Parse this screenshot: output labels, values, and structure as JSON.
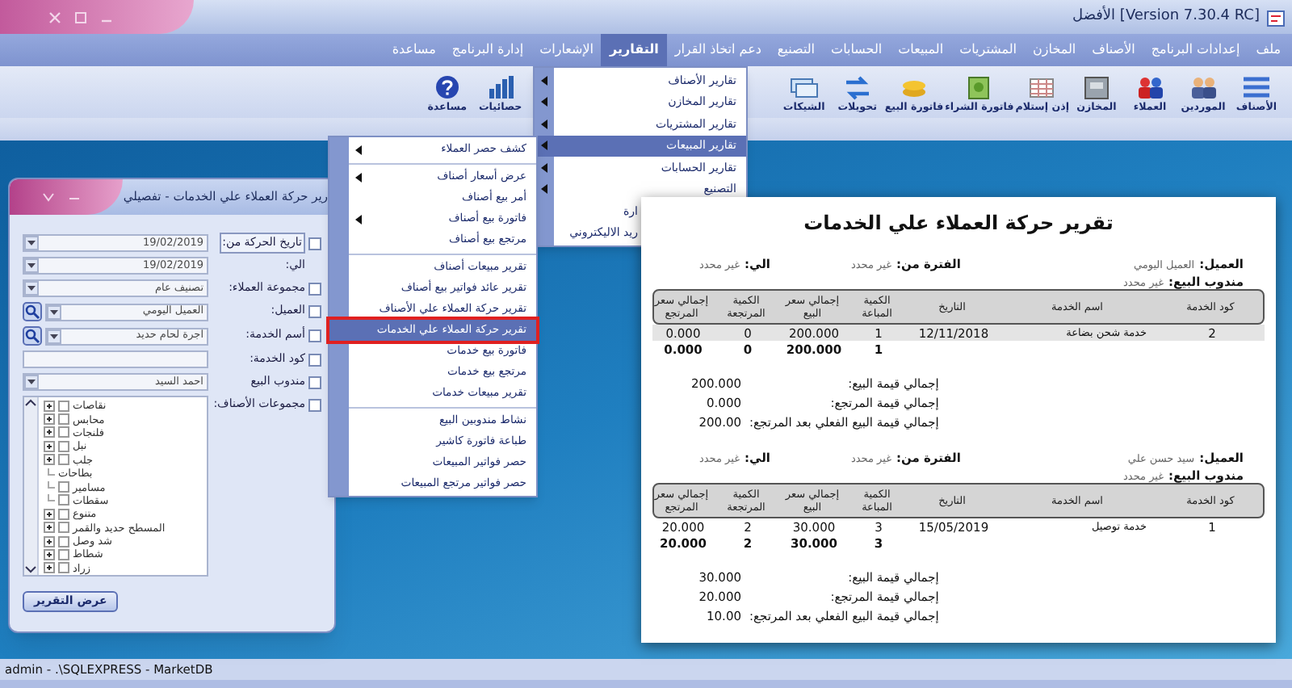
{
  "window": {
    "title": "[Version 7.30.4 RC] الأفضل"
  },
  "menu_bar": [
    {
      "label": "ملف",
      "selected": false
    },
    {
      "label": "إعدادات البرنامج",
      "selected": false
    },
    {
      "label": "الأصناف",
      "selected": false
    },
    {
      "label": "المخازن",
      "selected": false
    },
    {
      "label": "المشتريات",
      "selected": false
    },
    {
      "label": "المبيعات",
      "selected": false
    },
    {
      "label": "الحسابات",
      "selected": false
    },
    {
      "label": "التصنيع",
      "selected": false
    },
    {
      "label": "دعم اتخاذ القرار",
      "selected": false
    },
    {
      "label": "التقارير",
      "selected": true
    },
    {
      "label": "الإشعارات",
      "selected": false
    },
    {
      "label": "إدارة البرنامج",
      "selected": false
    },
    {
      "label": "مساعدة",
      "selected": false
    }
  ],
  "toolbar": [
    {
      "items": [
        "الأصناف",
        "الموردين",
        "العملاء",
        "المخازن",
        "إذن إستلام",
        "فاتورة الشراء",
        "فاتورة البيع",
        "تحويلات",
        "الشيكات"
      ]
    },
    {
      "items": [
        "حصائيات",
        "مساعدة"
      ]
    }
  ],
  "reports_menu": {
    "items": [
      {
        "label": "تقارير الأصناف",
        "has_submenu": true,
        "selected": false,
        "covered": false
      },
      {
        "label": "تقارير المخازن",
        "has_submenu": true,
        "selected": false,
        "covered": false
      },
      {
        "label": "تقارير المشتريات",
        "has_submenu": true,
        "selected": false,
        "covered": false
      },
      {
        "label": "تقارير المبيعات",
        "has_submenu": true,
        "selected": true,
        "covered": false
      },
      {
        "label": "تقارير الحسابات",
        "has_submenu": true,
        "selected": false,
        "covered": false
      },
      {
        "label": "التصنيع",
        "has_submenu": true,
        "selected": false,
        "covered": false
      },
      {
        "label": "ارة",
        "has_submenu": false,
        "selected": false,
        "covered": true
      },
      {
        "label": "ريد الاليكتروني",
        "has_submenu": false,
        "selected": false,
        "covered": true
      }
    ]
  },
  "sales_submenu": {
    "groups": [
      {
        "items": [
          {
            "label": "كشف حصر العملاء",
            "has_submenu": true,
            "selected": false
          }
        ]
      },
      {
        "items": [
          {
            "label": "عرض أسعار أصناف",
            "has_submenu": true,
            "selected": false
          },
          {
            "label": "أمر بيع أصناف",
            "has_submenu": false,
            "selected": false
          },
          {
            "label": "فاتورة بيع أصناف",
            "has_submenu": true,
            "selected": false
          },
          {
            "label": "مرتجع بيع أصناف",
            "has_submenu": false,
            "selected": false
          }
        ]
      },
      {
        "items": [
          {
            "label": "تقرير مبيعات أصناف",
            "has_submenu": false,
            "selected": false
          },
          {
            "label": "تقرير عائد فواتير بيع أصناف",
            "has_submenu": false,
            "selected": false
          },
          {
            "label": "تقرير حركة العملاء علي الأصناف",
            "has_submenu": false,
            "selected": false
          },
          {
            "label": "تقرير حركة العملاء علي الخدمات",
            "has_submenu": false,
            "selected": true
          },
          {
            "label": "فاتورة بيع خدمات",
            "has_submenu": false,
            "selected": false
          },
          {
            "label": "مرتجع بيع خدمات",
            "has_submenu": false,
            "selected": false
          },
          {
            "label": "تقرير مبيعات خدمات",
            "has_submenu": false,
            "selected": false
          }
        ]
      },
      {
        "items": [
          {
            "label": "نشاط مندوبين البيع",
            "has_submenu": false,
            "selected": false
          },
          {
            "label": "طباعة فاتورة كاشير",
            "has_submenu": false,
            "selected": false
          },
          {
            "label": "حصر فواتير المبيعات",
            "has_submenu": false,
            "selected": false
          },
          {
            "label": "حصر فواتير مرتجع المبيعات",
            "has_submenu": false,
            "selected": false
          }
        ]
      }
    ]
  },
  "report_dialog": {
    "title": "رير حركة العملاء علي الخدمات - تفصيلي",
    "filters": [
      {
        "label": "تاريخ الحركة من:",
        "checked": false,
        "kind": "date",
        "value": "19/02/2019"
      },
      {
        "label": "الي:",
        "kind": "date",
        "value": "19/02/2019"
      },
      {
        "label": "مجموعة العملاء:",
        "checked": false,
        "kind": "combo",
        "value": "تصنيف عام"
      },
      {
        "label": "العميل:",
        "checked": false,
        "kind": "combo_search",
        "value": "العميل اليومي"
      },
      {
        "label": "أسم الخدمة:",
        "checked": false,
        "kind": "combo_search",
        "value": "اجرة لحام حديد"
      },
      {
        "label": "كود الخدمة:",
        "checked": false,
        "kind": "text"
      },
      {
        "label": "مندوب البيع",
        "checked": false,
        "kind": "combo",
        "value": "احمد السيد"
      },
      {
        "label": "مجموعات الأصناف:",
        "checked": false,
        "kind": "tree",
        "items": [
          {
            "label": "نقاصات",
            "expandable": true,
            "checked": false
          },
          {
            "label": "محابس",
            "expandable": true,
            "checked": false
          },
          {
            "label": "فلنجات",
            "expandable": true,
            "checked": false
          },
          {
            "label": "نبل",
            "expandable": true,
            "checked": false
          },
          {
            "label": "جلب",
            "expandable": true,
            "checked": false
          },
          {
            "label": "بطاحات",
            "expandable": false
          },
          {
            "label": "مسامير",
            "expandable": false,
            "checked": false
          },
          {
            "label": "سقطات",
            "expandable": false,
            "checked": false
          },
          {
            "label": "متنوع",
            "expandable": true,
            "checked": false
          },
          {
            "label": "المسطح حديد والقمر",
            "expandable": true,
            "checked": false
          },
          {
            "label": "شد وصل",
            "expandable": true,
            "checked": false
          },
          {
            "label": "شطاط",
            "expandable": true,
            "checked": false
          },
          {
            "label": "زراد",
            "expandable": true,
            "checked": false
          }
        ]
      }
    ],
    "button": "عرض التقرير"
  },
  "report": {
    "title": "تقرير حركة العملاء علي الخدمات",
    "groups": [
      {
        "columns": [
          "كود الخدمة",
          "اسم الخدمة",
          "التاريخ",
          "الكمية المباعة",
          "إجمالي سعر البيع",
          "الكمية المرتجعة",
          "إجمالي سعر المرتجع"
        ],
        "client_label": "العميل:",
        "client": "العميل اليومي",
        "rep_label": "مندوب البيع:",
        "rep": "غير محدد",
        "from_label": "الفترة من:",
        "from": "غير محدد",
        "to_label": "الي:",
        "to": "غير محدد",
        "rows": [
          {
            "cells": [
              "2",
              "خدمة شحن بضاعة",
              "12/11/2018",
              "1",
              "200.000",
              "0",
              "0.000"
            ],
            "selected": true
          }
        ],
        "totals": [
          "1",
          "200.000",
          "0",
          "0.000"
        ],
        "summary": [
          {
            "label": "إجمالي قيمة البيع:",
            "value": "200.000"
          },
          {
            "label": "إجمالي قيمة المرتجع:",
            "value": "0.000"
          },
          {
            "label": "إجمالي قيمة البيع الفعلي بعد المرتجع:",
            "value": "200.00"
          }
        ]
      },
      {
        "columns": [
          "كود الخدمة",
          "اسم الخدمة",
          "التاريخ",
          "الكمية المباعة",
          "إجمالي سعر البيع",
          "الكمية المرتجعة",
          "إجمالي سعر المرتجع"
        ],
        "client_label": "العميل:",
        "client": "سيد حسن علي",
        "rep_label": "مندوب البيع:",
        "rep": "غير محدد",
        "from_label": "الفترة من:",
        "from": "غير محدد",
        "to_label": "الي:",
        "to": "غير محدد",
        "rows": [
          {
            "cells": [
              "1",
              "خدمة توصيل",
              "15/05/2019",
              "3",
              "30.000",
              "2",
              "20.000"
            ],
            "selected": false
          }
        ],
        "totals": [
          "3",
          "30.000",
          "2",
          "20.000"
        ],
        "summary": [
          {
            "label": "إجمالي قيمة البيع:",
            "value": "30.000"
          },
          {
            "label": "إجمالي قيمة المرتجع:",
            "value": "20.000"
          },
          {
            "label": "إجمالي قيمة البيع الفعلي بعد المرتجع:",
            "value": "10.00"
          }
        ]
      }
    ]
  },
  "status_bar": "admin - .\\SQLEXPRESS - MarketDB"
}
